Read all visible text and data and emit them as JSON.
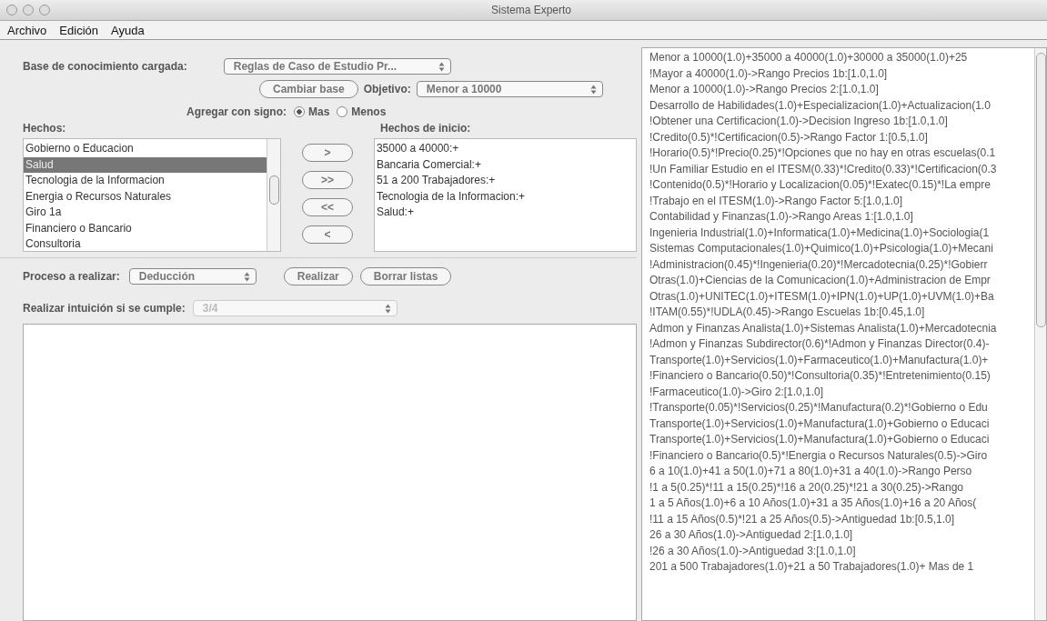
{
  "window": {
    "title": "Sistema Experto"
  },
  "menu": [
    "Archivo",
    "Edición",
    "Ayuda"
  ],
  "base": {
    "label": "Base de conocimiento cargada:",
    "value": "Reglas de Caso de Estudio Pr...",
    "disabled": false
  },
  "change_base_button": "Cambiar base",
  "objective": {
    "label": "Objetivo:",
    "value": "Menor a 10000",
    "disabled": false
  },
  "sign": {
    "label": "Agregar con signo:",
    "options": [
      {
        "label": "Mas",
        "selected": true
      },
      {
        "label": "Menos",
        "selected": false
      }
    ]
  },
  "facts": {
    "label": "Hechos:",
    "items": [
      {
        "text": "Gobierno o Educacion",
        "selected": false
      },
      {
        "text": "Salud",
        "selected": true
      },
      {
        "text": "Tecnologia de la Informacion",
        "selected": false
      },
      {
        "text": "Energia o Recursos Naturales",
        "selected": false
      },
      {
        "text": "Giro 1a",
        "selected": false
      },
      {
        "text": "Financiero o Bancario",
        "selected": false
      },
      {
        "text": "Consultoria",
        "selected": false
      }
    ]
  },
  "transfer_buttons": [
    ">",
    ">>",
    "<<",
    "<"
  ],
  "initial_facts": {
    "label": "Hechos de inicio:",
    "items": [
      "35000 a 40000:+",
      "Bancaria Comercial:+",
      "51 a 200 Trabajadores:+",
      "Tecnologia de la Informacion:+",
      "Salud:+"
    ]
  },
  "process": {
    "label": "Proceso a realizar:",
    "value": "Deducción",
    "disabled": false
  },
  "actions": [
    "Realizar",
    "Borrar listas"
  ],
  "intuition": {
    "label": "Realizar intuición si se cumple:",
    "value": "3/4",
    "disabled": true
  },
  "rules": [
    "Menor a 10000(1.0)+35000 a 40000(1.0)+30000 a 35000(1.0)+25",
    "!Mayor a 40000(1.0)->Rango Precios 1b:[1.0,1.0]",
    "Menor a 10000(1.0)->Rango Precios 2:[1.0,1.0]",
    "Desarrollo de Habilidades(1.0)+Especializacion(1.0)+Actualizacion(1.0",
    "!Obtener una Certificacion(1.0)->Decision Ingreso 1b:[1.0,1.0]",
    "!Credito(0.5)*!Certificacion(0.5)->Rango Factor 1:[0.5,1.0]",
    "!Horario(0.5)*!Precio(0.25)*!Opciones que no hay en otras escuelas(0.1",
    "!Un Familiar Estudio en el ITESM(0.33)*!Credito(0.33)*!Certificacion(0.3",
    "!Contenido(0.5)*!Horario y Localizacion(0.05)*!Exatec(0.15)*!La empre",
    "!Trabajo en el ITESM(1.0)->Rango Factor 5:[1.0,1.0]",
    "Contabilidad y Finanzas(1.0)->Rango Areas 1:[1.0,1.0]",
    "Ingenieria Industrial(1.0)+Informatica(1.0)+Medicina(1.0)+Sociologia(1",
    "Sistemas Computacionales(1.0)+Quimico(1.0)+Psicologia(1.0)+Mecani",
    "!Administracion(0.45)*!Ingenieria(0.20)*!Mercadotecnia(0.25)*!Gobierr",
    "Otras(1.0)+Ciencias de la Comunicacion(1.0)+Administracion de Empr",
    "Otras(1.0)+UNITEC(1.0)+ITESM(1.0)+IPN(1.0)+UP(1.0)+UVM(1.0)+Ba",
    "!ITAM(0.55)*!UDLA(0.45)->Rango Escuelas 1b:[0.45,1.0]",
    "Admon y Finanzas Analista(1.0)+Sistemas Analista(1.0)+Mercadotecnia",
    "!Admon y Finanzas Subdirector(0.6)*!Admon y Finanzas Director(0.4)-",
    "Transporte(1.0)+Servicios(1.0)+Farmaceutico(1.0)+Manufactura(1.0)+",
    "!Financiero o Bancario(0.50)*!Consultoria(0.35)*!Entretenimiento(0.15)",
    "!Farmaceutico(1.0)->Giro 2:[1.0,1.0]",
    "!Transporte(0.05)*!Servicios(0.25)*!Manufactura(0.2)*!Gobierno o Edu",
    "Transporte(1.0)+Servicios(1.0)+Manufactura(1.0)+Gobierno o Educaci",
    "Transporte(1.0)+Servicios(1.0)+Manufactura(1.0)+Gobierno o Educaci",
    "!Financiero o Bancario(0.5)*!Energia o Recursos Naturales(0.5)->Giro",
    "6 a 10(1.0)+41 a 50(1.0)+71 a 80(1.0)+31 a 40(1.0)->Rango Perso",
    "!1 a 5(0.25)*!11 a 15(0.25)*!16 a 20(0.25)*!21 a 30(0.25)->Rango",
    "1 a 5 Años(1.0)+6 a 10 Años(1.0)+31 a 35 Años(1.0)+16 a 20 Años(",
    "!11 a 15 Años(0.5)*!21 a 25 Años(0.5)->Antiguedad 1b:[0.5,1.0]",
    "26 a 30 Años(1.0)->Antiguedad 2:[1.0,1.0]",
    "!26 a 30 Años(1.0)->Antiguedad 3:[1.0,1.0]",
    "201 a 500 Trabajadores(1.0)+21 a 50 Trabajadores(1.0)+ Mas de 1"
  ]
}
